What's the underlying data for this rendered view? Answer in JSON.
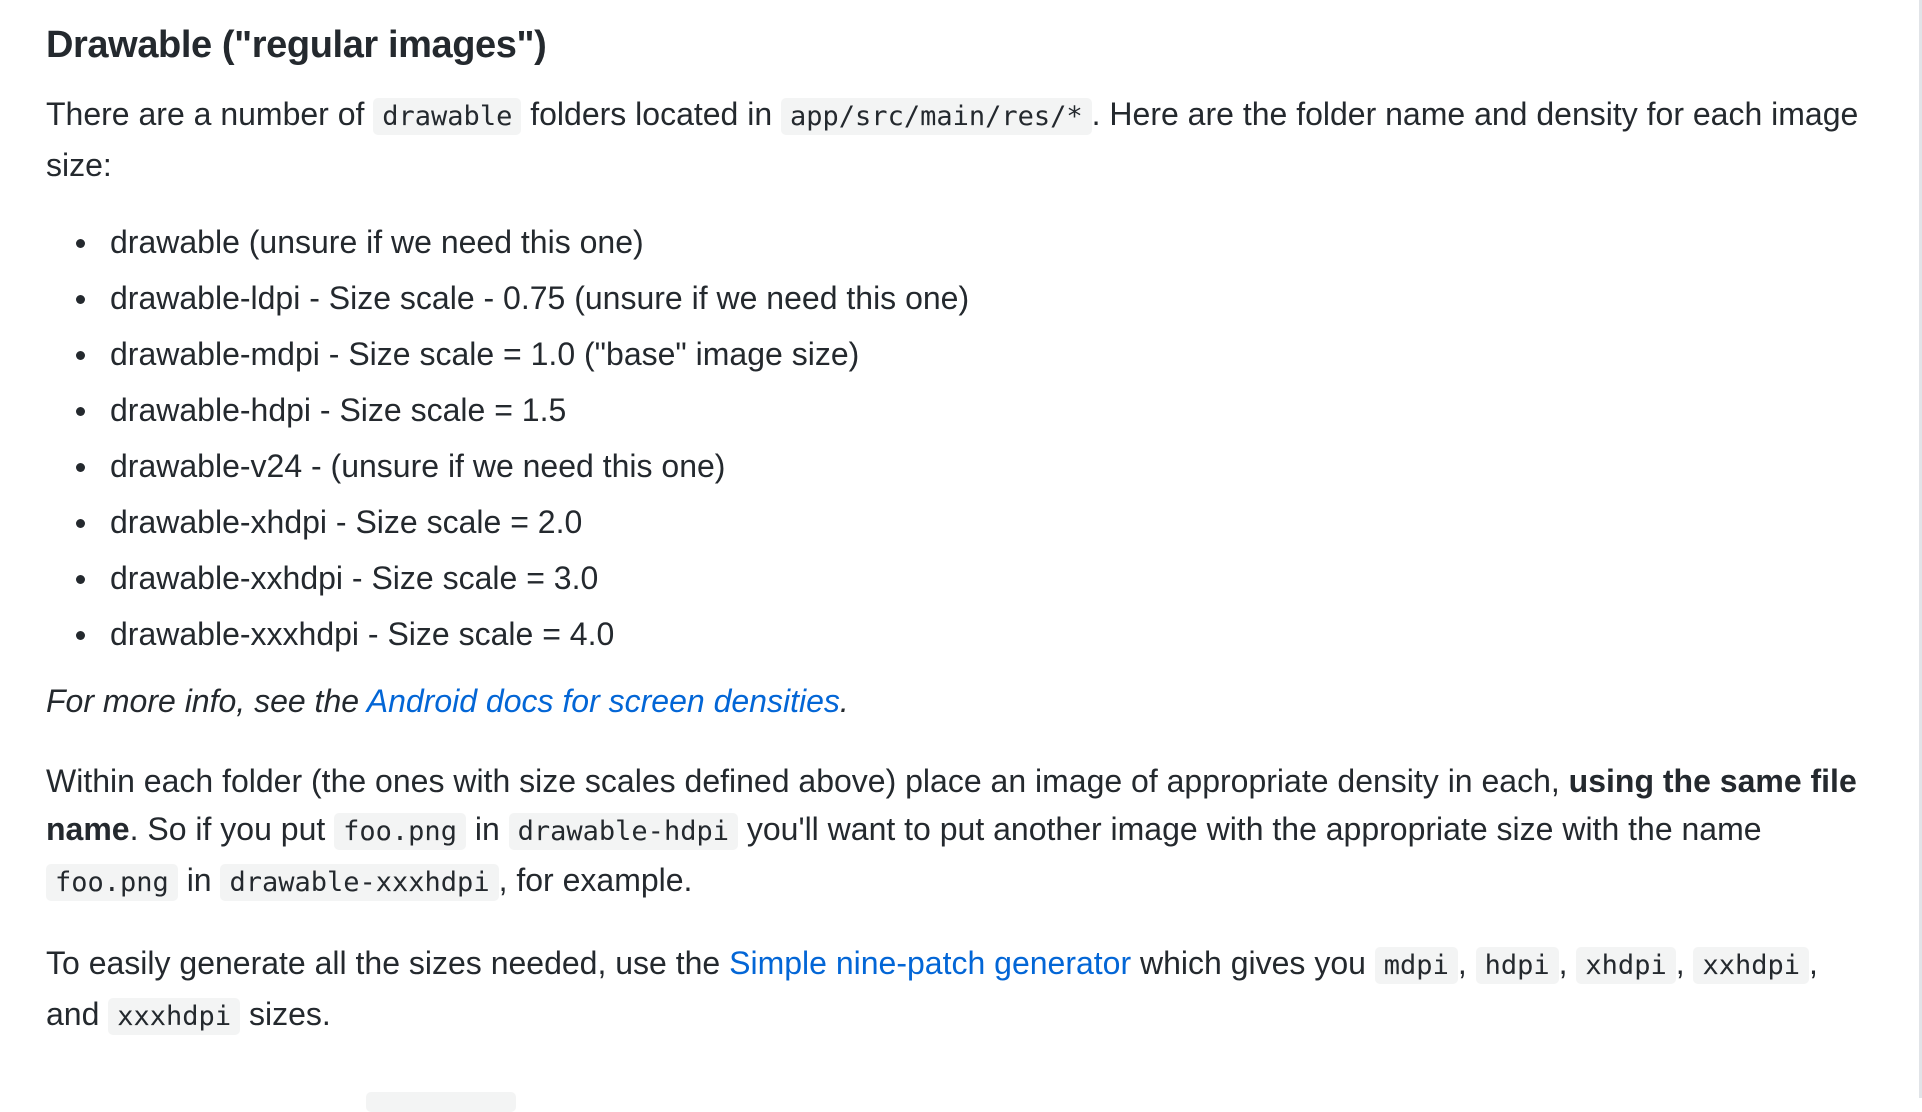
{
  "heading": "Drawable (\"regular images\")",
  "intro": {
    "t1": "There are a number of ",
    "c1": "drawable",
    "t2": " folders located in ",
    "c2": "app/src/main/res/*",
    "t3": ". Here are the folder name and density for each image size:"
  },
  "folders": [
    "drawable (unsure if we need this one)",
    "drawable-ldpi - Size scale - 0.75 (unsure if we need this one)",
    "drawable-mdpi - Size scale = 1.0 (\"base\" image size)",
    "drawable-hdpi - Size scale = 1.5",
    "drawable-v24 - (unsure if we need this one)",
    "drawable-xhdpi - Size scale = 2.0",
    "drawable-xxhdpi - Size scale = 3.0",
    "drawable-xxxhdpi - Size scale = 4.0"
  ],
  "more_info": {
    "prefix": "For more info, see the ",
    "link": "Android docs for screen densities",
    "suffix": "."
  },
  "within": {
    "t1": "Within each folder (the ones with size scales defined above) place an image of appropriate density in each, ",
    "bold": "using the same file name",
    "t2": ". So if you put ",
    "c1": "foo.png",
    "t3": " in ",
    "c2": "drawable-hdpi",
    "t4": " you'll want to put another image with the appropriate size with the name ",
    "c3": "foo.png",
    "t5": " in ",
    "c4": "drawable-xxxhdpi",
    "t6": ", for example."
  },
  "easily": {
    "t1": "To easily generate all the sizes needed, use the ",
    "link": "Simple nine-patch generator",
    "t2": " which gives you ",
    "c1": "mdpi",
    "s1": ", ",
    "c2": "hdpi",
    "s2": ", ",
    "c3": "xhdpi",
    "s3": ", ",
    "c4": "xxhdpi",
    "s4": ", and ",
    "c5": "xxxhdpi",
    "t3": " sizes."
  }
}
